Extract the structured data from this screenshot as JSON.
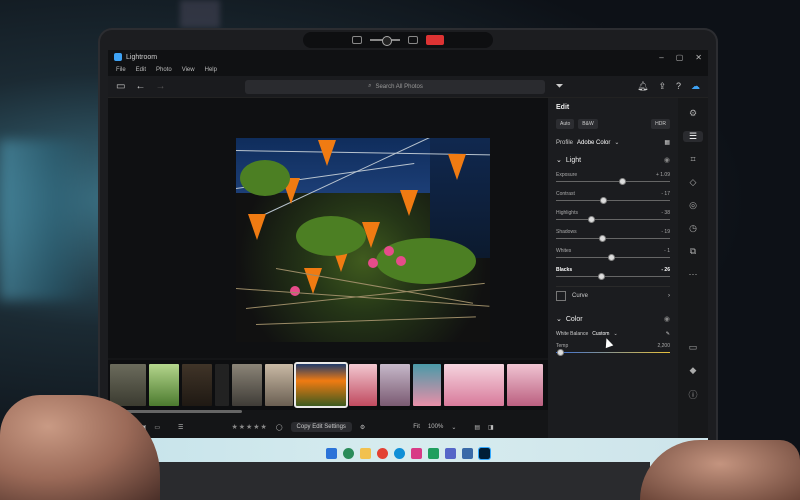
{
  "app": {
    "title": "Lightroom",
    "window_controls": [
      "–",
      "▢",
      "✕"
    ]
  },
  "menu": [
    "File",
    "Edit",
    "Photo",
    "View",
    "Help"
  ],
  "toolbar": {
    "search_placeholder": "Search All Photos"
  },
  "edit_panel": {
    "title": "Edit",
    "modes": [
      "Auto",
      "B&W",
      "HDR"
    ],
    "profile_label": "Profile",
    "profile_value": "Adobe Color",
    "light_section": "Light",
    "sliders": [
      {
        "name": "Exposure",
        "value": "+ 1.09",
        "position": 0.58
      },
      {
        "name": "Contrast",
        "value": "- 17",
        "position": 0.42
      },
      {
        "name": "Highlights",
        "value": "- 38",
        "position": 0.31
      },
      {
        "name": "Shadows",
        "value": "- 19",
        "position": 0.41
      },
      {
        "name": "Whites",
        "value": "- 1",
        "position": 0.49
      },
      {
        "name": "Blacks",
        "value": "- 26",
        "position": 0.4
      }
    ],
    "curve_label": "Curve",
    "color_section": "Color",
    "white_balance_label": "White Balance",
    "white_balance_value": "Custom",
    "temp_label": "Temp",
    "temp_value": "2,200"
  },
  "bottom_bar": {
    "copy_edit": "Copy Edit Settings",
    "fit_label": "Fit",
    "zoom": "100%"
  },
  "colors": {
    "accent": "#3ea2f4",
    "flag": "#f07b12",
    "taskbar": "#cfe6ec"
  },
  "icons": {
    "rail": [
      "gear-icon",
      "sliders-icon",
      "crop-icon",
      "eraser-icon",
      "mask-icon",
      "history-icon",
      "presets-icon",
      "more-icon"
    ],
    "rail_bottom": [
      "comment-icon",
      "tag-icon",
      "info-icon"
    ]
  }
}
